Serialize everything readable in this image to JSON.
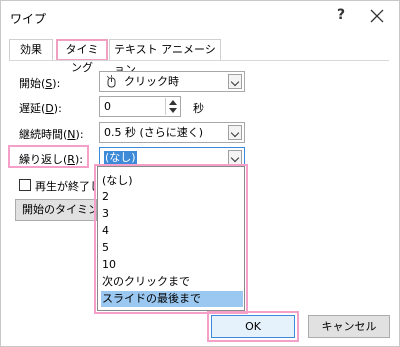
{
  "window": {
    "title": "ワイプ",
    "help_label": "?"
  },
  "tabs": [
    {
      "label": "効果"
    },
    {
      "label": "タイミング"
    },
    {
      "label": "テキスト アニメーション"
    }
  ],
  "timing": {
    "start_label": "開始(",
    "start_key": "S",
    "start_suffix": "):",
    "start_value": "クリック時",
    "delay_label": "遅延(",
    "delay_key": "D",
    "delay_suffix": "):",
    "delay_value": "0",
    "delay_unit": "秒",
    "duration_label": "継続時間(",
    "duration_key": "N",
    "duration_suffix": "):",
    "duration_value": "0.5 秒 (さらに速く)",
    "repeat_label": "繰り返し(",
    "repeat_key": "R",
    "repeat_suffix": "):",
    "repeat_value": "(なし)",
    "rewind_label": "再生が終了し",
    "triggers_label": "開始のタイミング"
  },
  "repeat_options": [
    "(なし)",
    "2",
    "3",
    "4",
    "5",
    "10",
    "次のクリックまで",
    "スライドの最後まで"
  ],
  "repeat_highlighted_index": 7,
  "footer": {
    "ok_label": "OK",
    "cancel_label": "キャンセル"
  },
  "colors": {
    "highlight": "#f5a0c8",
    "selection": "#9bc8f0"
  }
}
